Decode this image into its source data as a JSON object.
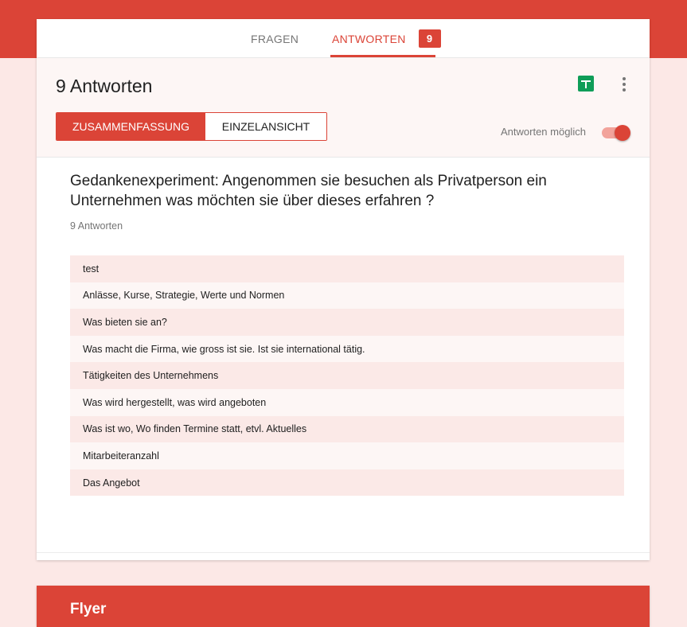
{
  "tabs": {
    "questions_label": "FRAGEN",
    "responses_label": "ANTWORTEN",
    "responses_badge": "9"
  },
  "header": {
    "title": "9 Antworten",
    "sheets_icon": "sheets-icon",
    "more_icon": "more-vert-icon",
    "view_toggle": {
      "summary_label": "ZUSAMMENFASSUNG",
      "individual_label": "EINZELANSICHT",
      "selected": "summary"
    },
    "accepting_label": "Antworten möglich",
    "accepting_enabled": true
  },
  "question": {
    "title": "Gedankenexperiment: Angenommen sie besuchen als Privatperson ein Unternehmen was möchten sie über dieses erfahren ?",
    "response_count": "9 Antworten",
    "answers": [
      "test",
      "Anlässe, Kurse, Strategie, Werte und Normen",
      "Was bieten sie an?",
      "Was macht die Firma, wie gross ist sie. Ist sie international tätig.",
      "Tätigkeiten des Unternehmens",
      "Was wird hergestellt, was wird angeboten",
      "Was ist wo, Wo finden Termine statt, etvl. Aktuelles",
      "Mitarbeiteranzahl",
      "Das Angebot"
    ]
  },
  "next_section": {
    "title": "Flyer"
  },
  "colors": {
    "accent": "#db4437",
    "background": "#fce8e6",
    "sheets_green": "#0f9d58"
  }
}
